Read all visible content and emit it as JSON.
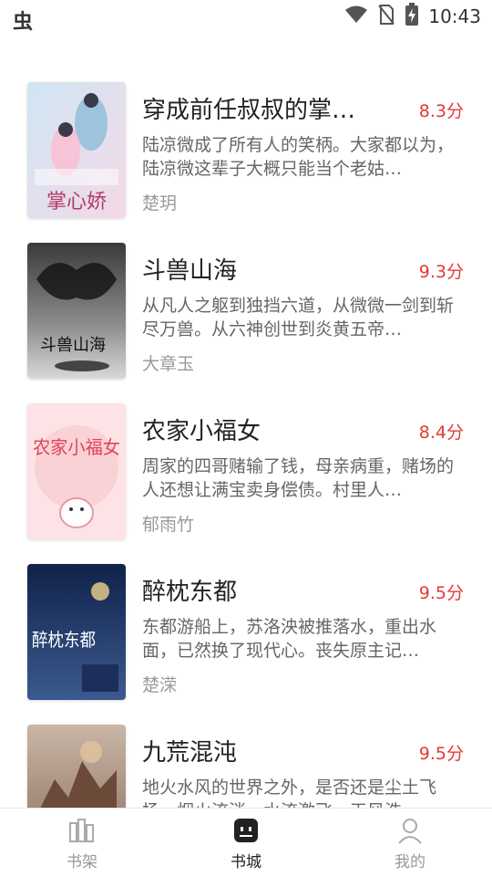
{
  "status_bar": {
    "app_glyph": "虫",
    "time": "10:43",
    "icons": [
      "wifi-icon",
      "no-sim-icon",
      "battery-charging-icon"
    ]
  },
  "books": [
    {
      "title": "穿成前任叔叔的掌…",
      "score": "8.3分",
      "description": "陆凉微成了所有人的笑柄。大家都以为，陆凉微这辈子大概只能当个老姑…",
      "author": "楚玥",
      "cover_text": "掌心娇",
      "cover_colors": [
        "#cfe6f4",
        "#f4d9e6"
      ]
    },
    {
      "title": "斗兽山海",
      "score": "9.3分",
      "description": "从凡人之躯到独挡六道，从微微一剑到斩尽万兽。从六神创世到炎黄五帝…",
      "author": "大章玉",
      "cover_text": "斗兽山海",
      "cover_colors": [
        "#3a3a3a",
        "#d8d8d8"
      ]
    },
    {
      "title": "农家小福女",
      "score": "8.4分",
      "description": "周家的四哥赌输了钱，母亲病重，赌场的人还想让满宝卖身偿债。村里人…",
      "author": "郁雨竹",
      "cover_text": "农家小福女",
      "cover_colors": [
        "#fde3e6",
        "#f7c6cc"
      ]
    },
    {
      "title": "醉枕东都",
      "score": "9.5分",
      "description": "东都游船上，苏洛泱被推落水，重出水面，已然换了现代心。丧失原主记…",
      "author": "楚溁",
      "cover_text": "醉枕东都",
      "cover_colors": [
        "#10224a",
        "#3b5a8f"
      ]
    },
    {
      "title": "九荒混沌",
      "score": "9.5分",
      "description": "地火水风的世界之外，是否还是尘土飞扬，烟火流淌，水流激飞，天风浩…",
      "author": "",
      "cover_text": "",
      "cover_colors": [
        "#8a6b5a",
        "#c9b7a7"
      ]
    }
  ],
  "tabs": [
    {
      "label": "书架",
      "icon": "bookshelf-icon",
      "active": false
    },
    {
      "label": "书城",
      "icon": "bookstore-icon",
      "active": true
    },
    {
      "label": "我的",
      "icon": "profile-icon",
      "active": false
    }
  ],
  "colors": {
    "score": "#e53935",
    "active_tab": "#222222",
    "inactive_tab": "#999999"
  }
}
